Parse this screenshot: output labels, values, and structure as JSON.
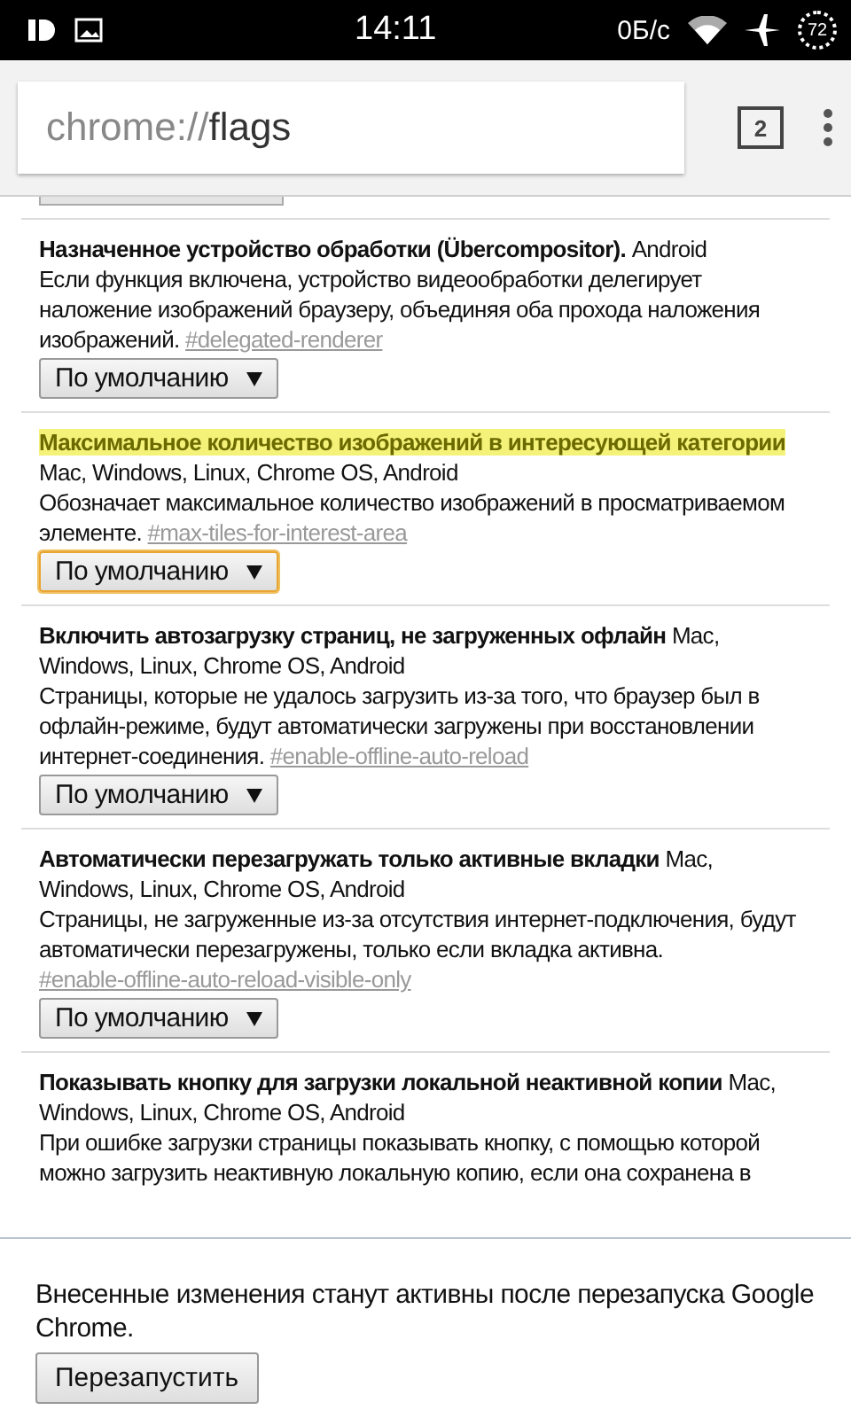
{
  "status_bar": {
    "time": "14:11",
    "speed": "0Б/с",
    "battery": "72"
  },
  "toolbar": {
    "url_scheme": "chrome://",
    "url_path": "flags",
    "tab_count": "2"
  },
  "flags": [
    {
      "title": "Назначенное устройство обработки (Übercompositor).",
      "platforms": "Android",
      "description": "Если функция включена, устройство видеообработки делегирует наложение изображений браузеру, объединяя оба прохода наложения изображений.",
      "link": "#delegated-renderer",
      "select": "По умолчанию",
      "highlighted": false,
      "focused": false
    },
    {
      "title": "Максимальное количество изображений в интересующей категории",
      "platforms": "Mac, Windows, Linux, Chrome OS, Android",
      "description": "Обозначает максимальное количество изображений в просматриваемом элементе.",
      "link": "#max-tiles-for-interest-area",
      "select": "По умолчанию",
      "highlighted": true,
      "focused": true
    },
    {
      "title": "Включить автозагрузку страниц, не загруженных офлайн",
      "platforms": "Mac, Windows, Linux, Chrome OS, Android",
      "description": "Страницы, которые не удалось загрузить из-за того, что браузер был в офлайн-режиме, будут автоматически загружены при восстановлении интернет-соединения.",
      "link": "#enable-offline-auto-reload",
      "select": "По умолчанию",
      "highlighted": false,
      "focused": false
    },
    {
      "title": "Автоматически перезагружать только активные вкладки",
      "platforms": "Mac, Windows, Linux, Chrome OS, Android",
      "description": "Страницы, не загруженные из-за отсутствия интернет-подключения, будут автоматически перезагружены, только если вкладка активна.",
      "link": "#enable-offline-auto-reload-visible-only",
      "select": "По умолчанию",
      "highlighted": false,
      "focused": false
    },
    {
      "title": "Показывать кнопку для загрузки локальной неактивной копии",
      "platforms": "Mac, Windows, Linux, Chrome OS, Android",
      "description": "При ошибке загрузки страницы показывать кнопку, с помощью которой можно загрузить неактивную локальную копию, если она сохранена в",
      "highlighted": false
    }
  ],
  "restart_bar": {
    "message": "Внесенные изменения станут активны после перезапуска Google Chrome.",
    "button": "Перезапустить"
  }
}
